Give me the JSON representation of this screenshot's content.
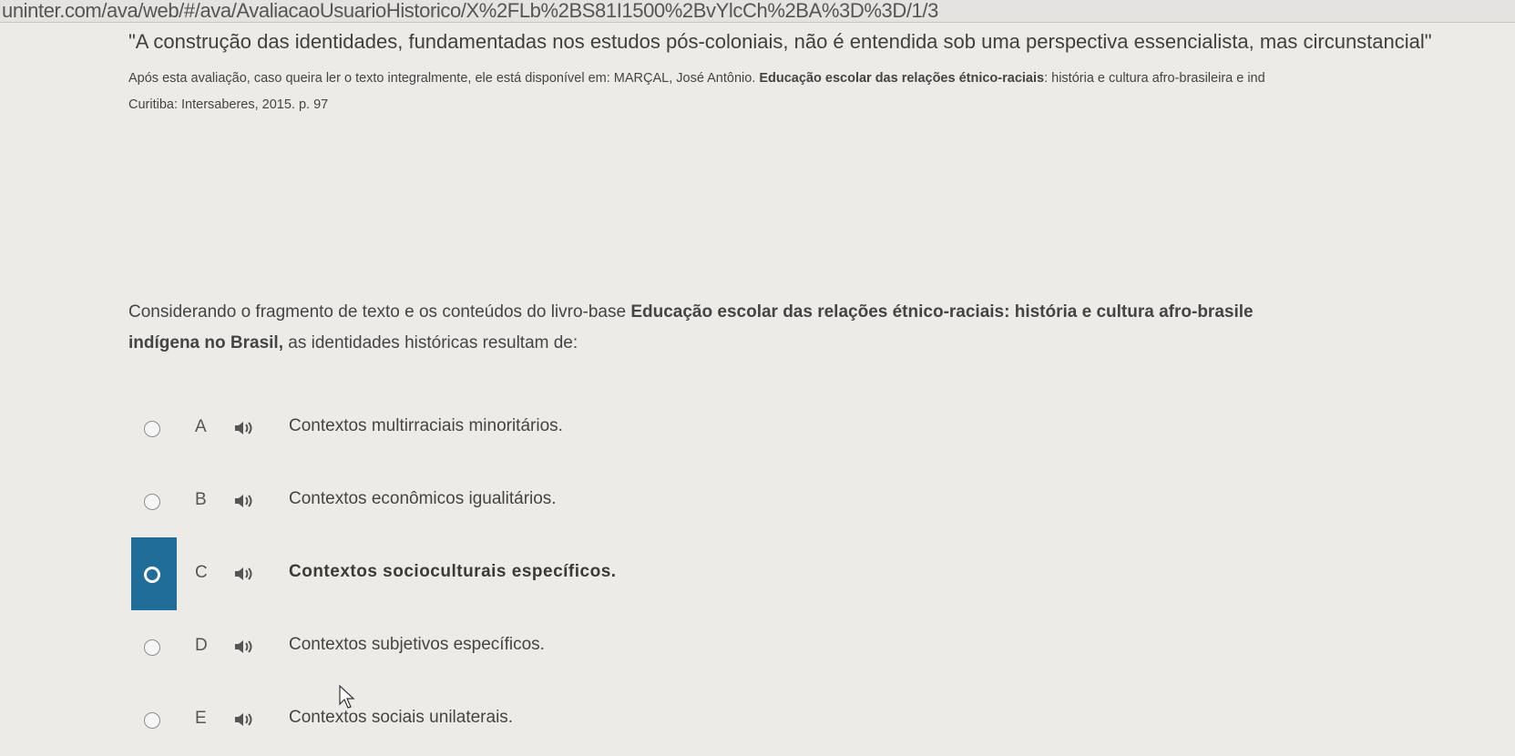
{
  "browser": {
    "url": "uninter.com/ava/web/#/ava/AvaliacaoUsuarioHistorico/X%2FLb%2BS81I1500%2BvYlcCh%2BA%3D%3D/1/3"
  },
  "question": {
    "quote": "\"A construção das identidades, fundamentadas nos estudos pós-coloniais, não é entendida sob uma perspectiva essencialista, mas circunstancial\"",
    "source_prefix": "Após esta avaliação, caso queira ler o texto integralmente, ele está disponível em: MARÇAL, José Antônio. ",
    "source_title": "Educação escolar das relações étnico-raciais",
    "source_suffix": ": história e cultura afro-brasileira e ind",
    "source_city": "Curitiba: Intersaberes, 2015. p. 97",
    "prompt_start": "Considerando o fragmento de texto e os conteúdos do livro-base ",
    "prompt_book_1": "Educação escolar das relações étnico-raciais: história e cultura afro-brasile",
    "prompt_book_2": "indígena no Brasil,",
    "prompt_end": " as identidades históricas  resultam de:"
  },
  "options": [
    {
      "letter": "A",
      "text": "Contextos multirraciais minoritários.",
      "selected": false
    },
    {
      "letter": "B",
      "text": "Contextos econômicos igualitários.",
      "selected": false
    },
    {
      "letter": "C",
      "text": "Contextos socioculturais específicos.",
      "selected": true
    },
    {
      "letter": "D",
      "text": "Contextos subjetivos específicos.",
      "selected": false
    },
    {
      "letter": "E",
      "text": "Contextos sociais unilaterais.",
      "selected": false
    }
  ],
  "icons": {
    "audio": "speaker-icon",
    "cursor": "mouse-pointer-icon"
  },
  "colors": {
    "selected": "#1f6d98",
    "background": "#ecebe8"
  }
}
